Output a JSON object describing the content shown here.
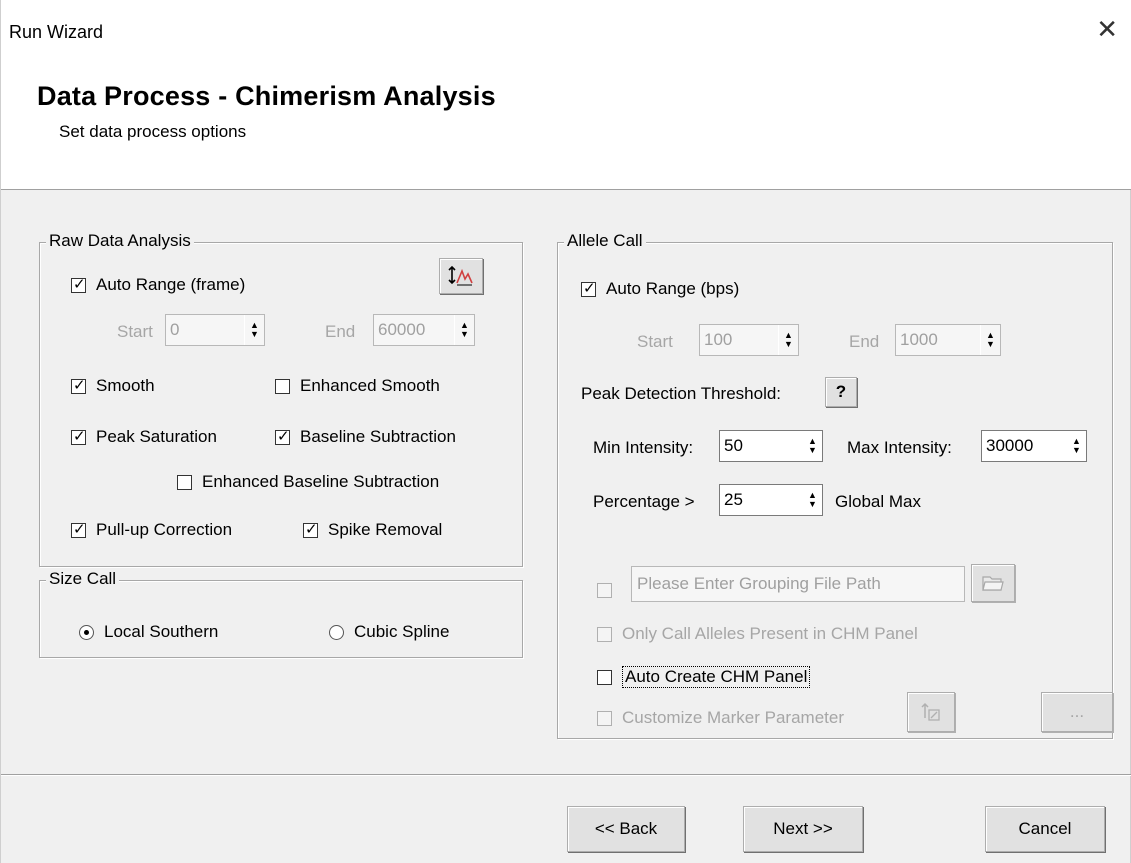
{
  "window": {
    "title": "Run Wizard",
    "close_glyph": "✕"
  },
  "header": {
    "title": "Data Process - Chimerism Analysis",
    "subtitle": "Set data process options"
  },
  "raw": {
    "legend": "Raw Data Analysis",
    "auto_range_label": "Auto Range (frame)",
    "auto_range_checked": true,
    "start_label": "Start",
    "start_value": "0",
    "end_label": "End",
    "end_value": "60000",
    "smooth_label": "Smooth",
    "smooth_checked": true,
    "enh_smooth_label": "Enhanced Smooth",
    "enh_smooth_checked": false,
    "peak_sat_label": "Peak Saturation",
    "peak_sat_checked": true,
    "baseline_label": "Baseline Subtraction",
    "baseline_checked": true,
    "enh_baseline_label": "Enhanced Baseline Subtraction",
    "enh_baseline_checked": false,
    "pullup_label": "Pull-up Correction",
    "pullup_checked": true,
    "spike_label": "Spike Removal",
    "spike_checked": true
  },
  "size_call": {
    "legend": "Size Call",
    "local_southern_label": "Local Southern",
    "local_southern_selected": true,
    "cubic_spline_label": "Cubic Spline",
    "cubic_spline_selected": false
  },
  "allele": {
    "legend": "Allele Call",
    "auto_range_label": "Auto Range (bps)",
    "auto_range_checked": true,
    "start_label": "Start",
    "start_value": "100",
    "end_label": "End",
    "end_value": "1000",
    "peak_threshold_label": "Peak Detection Threshold:",
    "help_label": "?",
    "min_intensity_label": "Min Intensity:",
    "min_intensity_value": "50",
    "max_intensity_label": "Max Intensity:",
    "max_intensity_value": "30000",
    "percentage_label": "Percentage >",
    "percentage_value": "25",
    "global_max_label": "Global Max",
    "grouping_placeholder": "Please Enter Grouping File Path",
    "only_call_label": "Only Call Alleles Present in CHM Panel",
    "auto_create_label": "Auto Create CHM Panel",
    "customize_label": "Customize Marker Parameter",
    "more_label": "..."
  },
  "footer": {
    "back": "<< Back",
    "next": "Next >>",
    "cancel": "Cancel"
  }
}
